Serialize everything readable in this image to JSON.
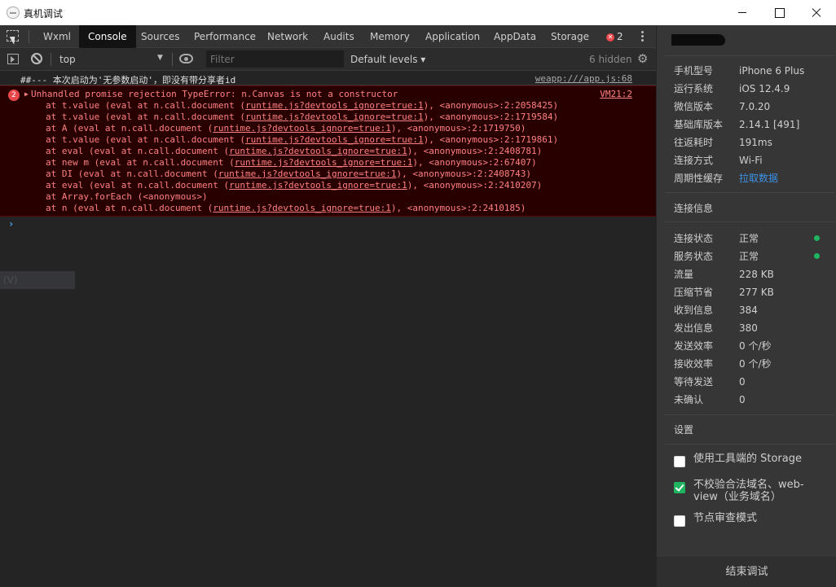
{
  "window": {
    "title": "真机调试",
    "icon": "wechat-devtools-icon"
  },
  "tabs": [
    "Wxml",
    "Console",
    "Sources",
    "Performance",
    "Network",
    "Audits",
    "Memory",
    "Application",
    "AppData",
    "Storage"
  ],
  "active_tab": "Console",
  "error_badge_count": "2",
  "filterbar": {
    "context": "top",
    "filter_placeholder": "Filter",
    "levels": "Default levels ▾",
    "hidden": "6 hidden"
  },
  "console": {
    "log": {
      "text": "##--- 本次启动为'无参数启动'，即没有带分享者id",
      "source": "weapp:///app.js:68"
    },
    "error": {
      "count": "2",
      "message": "Unhandled promise rejection TypeError: n.Canvas is not a constructor",
      "source": "VM21:2",
      "stack": [
        {
          "pre": "at t.value (eval at n.call.document (",
          "link": "runtime.js?devtools_ignore=true:1",
          "post": "), <anonymous>:2:2058425)"
        },
        {
          "pre": "at t.value (eval at n.call.document (",
          "link": "runtime.js?devtools_ignore=true:1",
          "post": "), <anonymous>:2:1719584)"
        },
        {
          "pre": "at A (eval at n.call.document (",
          "link": "runtime.js?devtools_ignore=true:1",
          "post": "), <anonymous>:2:1719750)"
        },
        {
          "pre": "at t.value (eval at n.call.document (",
          "link": "runtime.js?devtools_ignore=true:1",
          "post": "), <anonymous>:2:1719861)"
        },
        {
          "pre": "at eval (eval at n.call.document (",
          "link": "runtime.js?devtools_ignore=true:1",
          "post": "), <anonymous>:2:2408781)"
        },
        {
          "pre": "at new m (eval at n.call.document (",
          "link": "runtime.js?devtools_ignore=true:1",
          "post": "), <anonymous>:2:67407)"
        },
        {
          "pre": "at DI (eval at n.call.document (",
          "link": "runtime.js?devtools_ignore=true:1",
          "post": "), <anonymous>:2:2408743)"
        },
        {
          "pre": "at eval (eval at n.call.document (",
          "link": "runtime.js?devtools_ignore=true:1",
          "post": "), <anonymous>:2:2410207)"
        },
        {
          "pre": "at Array.forEach (<anonymous>)",
          "link": "",
          "post": ""
        },
        {
          "pre": "at n (eval at n.call.document (",
          "link": "runtime.js?devtools_ignore=true:1",
          "post": "), <anonymous>:2:2410185)"
        }
      ]
    },
    "prompt": "›",
    "suggestion": "(V)"
  },
  "device_info": [
    {
      "label": "手机型号",
      "value": "iPhone 6 Plus"
    },
    {
      "label": "运行系统",
      "value": "iOS 12.4.9"
    },
    {
      "label": "微信版本",
      "value": "7.0.20"
    },
    {
      "label": "基础库版本",
      "value": "2.14.1 [491]"
    },
    {
      "label": "往返耗时",
      "value": "191ms"
    },
    {
      "label": "连接方式",
      "value": "Wi-Fi"
    },
    {
      "label": "周期性缓存",
      "value": "拉取数据"
    }
  ],
  "connection": {
    "title": "连接信息",
    "rows": [
      {
        "label": "连接状态",
        "value": "正常",
        "status": "online"
      },
      {
        "label": "服务状态",
        "value": "正常",
        "status": "online"
      },
      {
        "label": "流量",
        "value": "228 KB"
      },
      {
        "label": "压缩节省",
        "value": "277 KB"
      },
      {
        "label": "收到信息",
        "value": "384"
      },
      {
        "label": "发出信息",
        "value": "380"
      },
      {
        "label": "发送效率",
        "value": "0 个/秒"
      },
      {
        "label": "接收效率",
        "value": "0 个/秒"
      },
      {
        "label": "等待发送",
        "value": "0"
      },
      {
        "label": "未确认",
        "value": "0"
      }
    ]
  },
  "settings": {
    "title": "设置",
    "options": [
      {
        "label": "使用工具端的 Storage",
        "checked": false
      },
      {
        "label": "不校验合法域名、web-view（业务域名）",
        "checked": true
      },
      {
        "label": "节点审查模式",
        "checked": false
      }
    ]
  },
  "end_button": "结束调试",
  "colors": {
    "accent": "#1fb560",
    "link": "#3c92e6",
    "error": "#ff8080",
    "error_bg": "#290000"
  }
}
